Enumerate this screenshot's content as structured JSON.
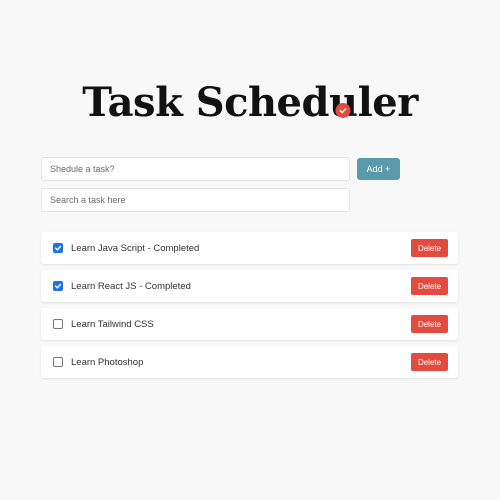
{
  "app": {
    "title_prefix": "Task Sched",
    "title_accent_letter": "u",
    "title_suffix": "ler",
    "accent_color": "#e34b3f"
  },
  "form": {
    "task_placeholder": "Shedule a task?",
    "task_value": "",
    "add_label": "Add +",
    "add_color": "#5a9aad",
    "search_placeholder": "Search a task here",
    "search_value": ""
  },
  "tasks": [
    {
      "label": "Learn Java Script - Completed",
      "checked": true,
      "delete_label": "Delete"
    },
    {
      "label": "Learn React JS - Completed",
      "checked": true,
      "delete_label": "Delete"
    },
    {
      "label": "Learn Tailwind CSS",
      "checked": false,
      "delete_label": "Delete"
    },
    {
      "label": "Learn Photoshop",
      "checked": false,
      "delete_label": "Delete"
    }
  ],
  "icons": {
    "title_badge": "checkmark-badge-icon",
    "checkbox_checked": "checkmark-icon"
  },
  "colors": {
    "delete": "#e34b3f",
    "checkbox_checked": "#1a73e8"
  }
}
